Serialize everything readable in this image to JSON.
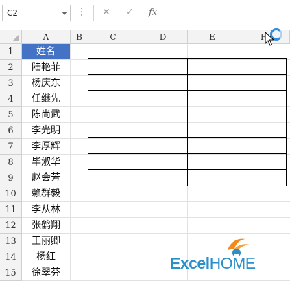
{
  "formula_bar": {
    "name_box": "C2",
    "cancel_symbol": "✕",
    "enter_symbol": "✓",
    "fx_symbol": "fx",
    "formula_value": ""
  },
  "columns": [
    "A",
    "B",
    "C",
    "D",
    "E",
    "F"
  ],
  "rows": [
    "1",
    "2",
    "3",
    "4",
    "5",
    "6",
    "7",
    "8",
    "9",
    "10",
    "11",
    "12",
    "13",
    "14",
    "15"
  ],
  "column_a": [
    "姓名",
    "陆艳菲",
    "杨庆东",
    "任继先",
    "陈尚武",
    "李光明",
    "李厚辉",
    "毕淑华",
    "赵会芳",
    "赖群毅",
    "李从林",
    "张鹤翔",
    "王丽卿",
    "杨红",
    "徐翠芬"
  ],
  "colors": {
    "header_fill": "#4472c4",
    "logo_blue": "#2b8fc9",
    "logo_orange": "#f08a1c"
  },
  "logo": {
    "part1": "Excel",
    "part2": "HOME"
  },
  "icons": {
    "cursor": "arrow-pointer-icon",
    "busy": "loading-spinner-icon"
  }
}
